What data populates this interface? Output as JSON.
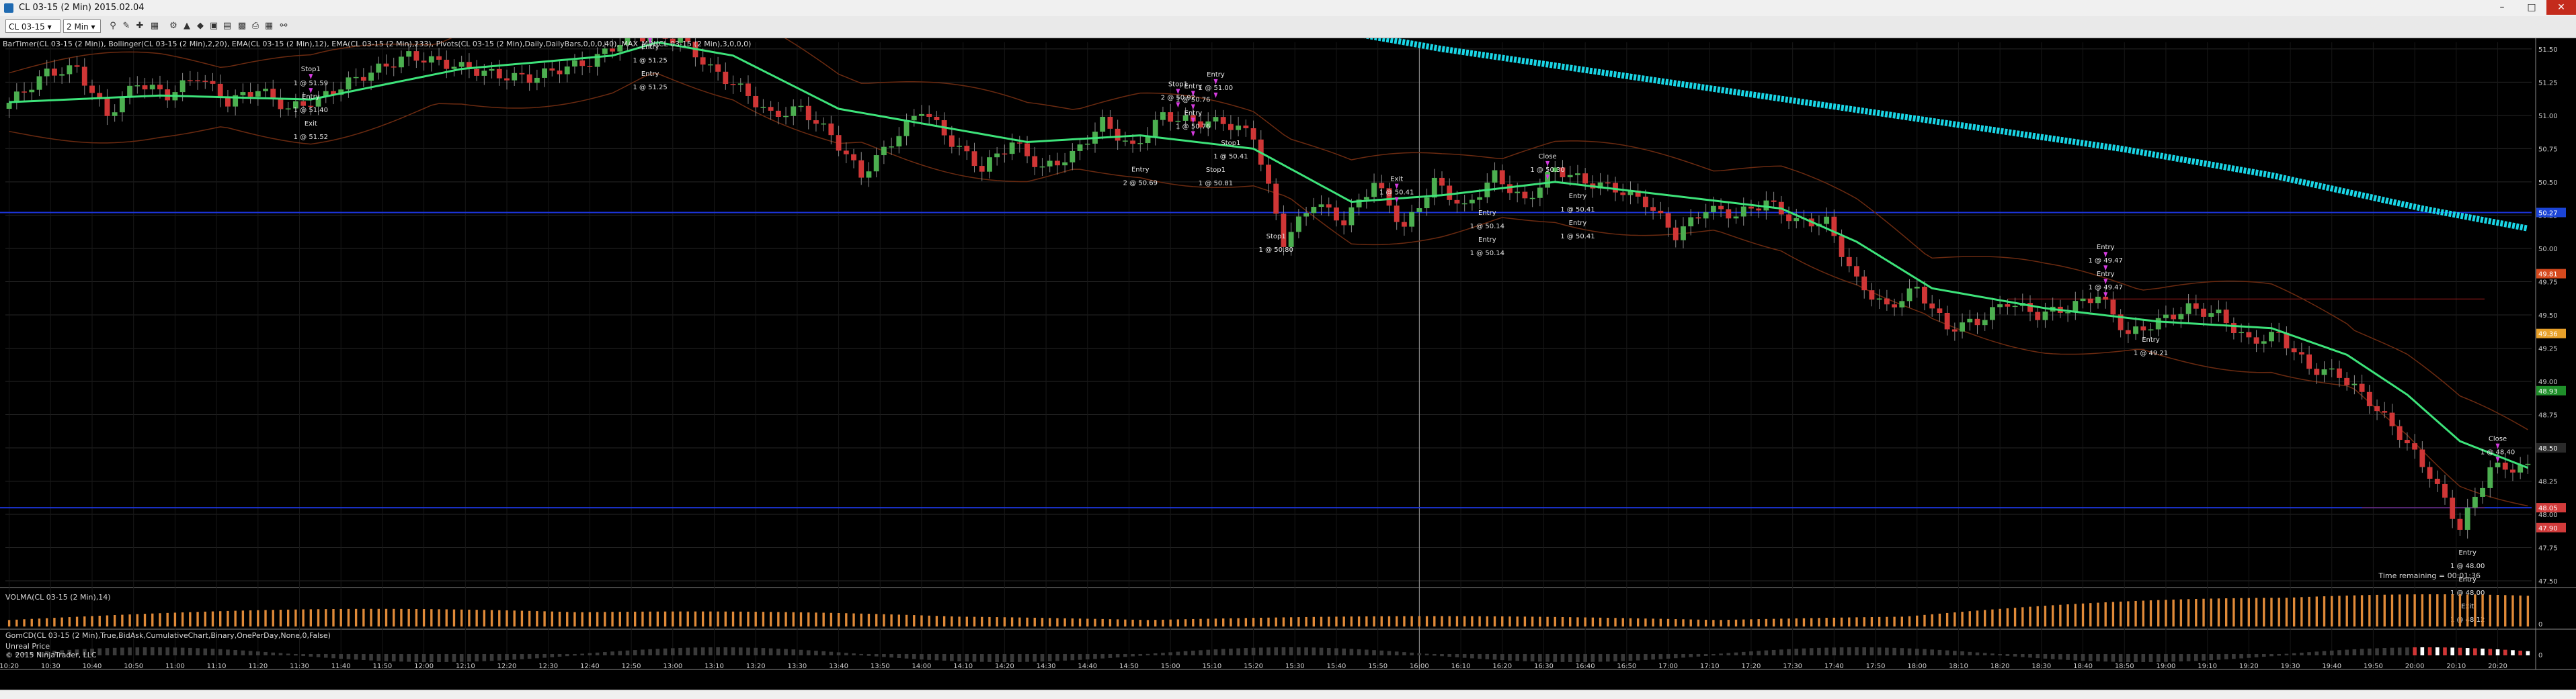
{
  "window": {
    "title": "CL 03-15 (2 Min)  2015.02.04",
    "min_label": "–",
    "max_label": "□",
    "close_label": "✕"
  },
  "toolbar": {
    "instrument": "CL 03-15 ▾",
    "interval": "2 Min ▾"
  },
  "indicators": {
    "price_panel": "BarTimer(CL 03-15 (2 Min)), Bollinger(CL 03-15 (2 Min),2,20), EMA(CL 03-15 (2 Min),12), EMA(CL 03-15 (2 Min),233), Pivots(CL 03-15 (2 Min),Daily,DailyBars,0,0,0,40), MAX_MIN(CL 03-15 (2 Min),3,0,0,0)",
    "volume_panel": "VOLMA(CL 03-15 (2 Min),14)",
    "cumdelta_panel": "GomCD(CL 03-15 (2 Min),True,BidAsk,CumulativeChart,Binary,OnePerDay,None,0,False)",
    "pos_sizing": "Unreal Price",
    "copyright": "© 2015 NinjaTrader, LLC",
    "time_remaining": "Time remaining = 00:01:36"
  },
  "chart_data": {
    "type": "candlestick",
    "title": "CL 03-15 (2 Min)",
    "ylim": [
      47.5,
      51.55
    ],
    "ylim_volume": [
      0,
      14000
    ],
    "price_ticks": [
      "51.50",
      "51.25",
      "51.00",
      "50.75",
      "50.50",
      "50.25",
      "50.00",
      "49.75",
      "49.50",
      "49.25",
      "49.00",
      "48.75",
      "48.50",
      "48.25",
      "48.00",
      "47.75",
      "47.50"
    ],
    "volume_ticks": [
      "0"
    ],
    "cumdelta_ticks": [
      "0"
    ],
    "time_ticks": [
      "10:20",
      "10:30",
      "10:40",
      "10:50",
      "11:00",
      "11:10",
      "11:20",
      "11:30",
      "11:40",
      "11:50",
      "12:00",
      "12:10",
      "12:20",
      "12:30",
      "12:40",
      "12:50",
      "13:00",
      "13:10",
      "13:20",
      "13:30",
      "13:40",
      "13:50",
      "14:00",
      "14:10",
      "14:20",
      "14:30",
      "14:40",
      "14:50",
      "15:00",
      "15:10",
      "15:20",
      "15:30",
      "15:40",
      "15:50",
      "16:00",
      "16:10",
      "16:20",
      "16:30",
      "16:40",
      "16:50",
      "17:00",
      "17:10",
      "17:20",
      "17:30",
      "17:40",
      "17:50",
      "18:00",
      "18:10",
      "18:20",
      "18:30",
      "18:40",
      "18:50",
      "19:00",
      "19:10",
      "19:20",
      "19:30",
      "19:40",
      "19:50",
      "20:00",
      "20:10",
      "20:20"
    ],
    "crosshair_time": "16:00",
    "price_path": [
      [
        0,
        51.05
      ],
      [
        6,
        51.32
      ],
      [
        10,
        51.35
      ],
      [
        14,
        51.0
      ],
      [
        18,
        51.25
      ],
      [
        22,
        51.15
      ],
      [
        26,
        51.3
      ],
      [
        30,
        51.1
      ],
      [
        34,
        51.2
      ],
      [
        38,
        51.05
      ],
      [
        42,
        51.12
      ],
      [
        46,
        51.25
      ],
      [
        50,
        51.35
      ],
      [
        54,
        51.45
      ],
      [
        58,
        51.4
      ],
      [
        62,
        51.35
      ],
      [
        66,
        51.3
      ],
      [
        70,
        51.28
      ],
      [
        74,
        51.35
      ],
      [
        78,
        51.4
      ],
      [
        82,
        51.55
      ],
      [
        84,
        51.6
      ],
      [
        90,
        51.58
      ],
      [
        94,
        51.35
      ],
      [
        98,
        51.2
      ],
      [
        102,
        51.0
      ],
      [
        106,
        51.05
      ],
      [
        110,
        50.85
      ],
      [
        114,
        50.55
      ],
      [
        118,
        50.8
      ],
      [
        122,
        51.05
      ],
      [
        126,
        50.8
      ],
      [
        130,
        50.6
      ],
      [
        134,
        50.8
      ],
      [
        138,
        50.6
      ],
      [
        142,
        50.7
      ],
      [
        146,
        50.95
      ],
      [
        150,
        50.75
      ],
      [
        154,
        51.0
      ],
      [
        158,
        50.95
      ],
      [
        162,
        50.95
      ],
      [
        166,
        50.85
      ],
      [
        170,
        50.05
      ],
      [
        174,
        50.35
      ],
      [
        178,
        50.2
      ],
      [
        182,
        50.5
      ],
      [
        186,
        50.15
      ],
      [
        190,
        50.5
      ],
      [
        194,
        50.3
      ],
      [
        198,
        50.55
      ],
      [
        202,
        50.35
      ],
      [
        206,
        50.6
      ],
      [
        210,
        50.5
      ],
      [
        214,
        50.45
      ],
      [
        218,
        50.35
      ],
      [
        222,
        50.1
      ],
      [
        226,
        50.3
      ],
      [
        230,
        50.25
      ],
      [
        234,
        50.35
      ],
      [
        238,
        50.2
      ],
      [
        242,
        50.2
      ],
      [
        246,
        49.75
      ],
      [
        250,
        49.55
      ],
      [
        254,
        49.7
      ],
      [
        258,
        49.4
      ],
      [
        262,
        49.45
      ],
      [
        266,
        49.6
      ],
      [
        270,
        49.5
      ],
      [
        274,
        49.55
      ],
      [
        278,
        49.65
      ],
      [
        282,
        49.35
      ],
      [
        286,
        49.45
      ],
      [
        290,
        49.55
      ],
      [
        294,
        49.5
      ],
      [
        298,
        49.3
      ],
      [
        302,
        49.35
      ],
      [
        306,
        49.1
      ],
      [
        310,
        49.05
      ],
      [
        314,
        48.85
      ],
      [
        318,
        48.6
      ],
      [
        322,
        48.3
      ],
      [
        326,
        47.9
      ],
      [
        330,
        48.35
      ],
      [
        334,
        48.35
      ]
    ],
    "ema12_path": [
      [
        0,
        51.1
      ],
      [
        20,
        51.15
      ],
      [
        40,
        51.12
      ],
      [
        60,
        51.35
      ],
      [
        80,
        51.45
      ],
      [
        86,
        51.55
      ],
      [
        96,
        51.45
      ],
      [
        110,
        51.05
      ],
      [
        120,
        50.95
      ],
      [
        135,
        50.8
      ],
      [
        150,
        50.85
      ],
      [
        165,
        50.75
      ],
      [
        178,
        50.35
      ],
      [
        190,
        50.4
      ],
      [
        205,
        50.5
      ],
      [
        220,
        50.4
      ],
      [
        235,
        50.3
      ],
      [
        245,
        50.05
      ],
      [
        255,
        49.7
      ],
      [
        270,
        49.55
      ],
      [
        285,
        49.45
      ],
      [
        300,
        49.4
      ],
      [
        310,
        49.2
      ],
      [
        318,
        48.9
      ],
      [
        325,
        48.55
      ],
      [
        334,
        48.35
      ]
    ],
    "ema233_path": [
      [
        170,
        51.7
      ],
      [
        190,
        51.5
      ],
      [
        220,
        51.25
      ],
      [
        250,
        51.0
      ],
      [
        280,
        50.75
      ],
      [
        300,
        50.55
      ],
      [
        320,
        50.3
      ],
      [
        334,
        50.15
      ]
    ],
    "pivot_lines": [
      50.27,
      48.05
    ],
    "pivot_tags": [
      "50.27",
      "48.05",
      "49.81",
      "49.36",
      "48.93",
      "48.50",
      "47.90"
    ],
    "cumdelta_values": [
      0
    ],
    "trade_labels": [
      {
        "pos": [
          40,
          49,
          0
        ],
        "text": "Stop1"
      },
      {
        "pos": [
          40,
          28,
          0
        ],
        "text": "1 @ 51.59"
      },
      {
        "pos": [
          40,
          8,
          1
        ],
        "text": "Entry"
      },
      {
        "pos": [
          40,
          -12,
          1
        ],
        "text": "1 @ 51.40"
      },
      {
        "pos": [
          40,
          -32,
          1
        ],
        "text": "Exit"
      },
      {
        "pos": [
          40,
          -52,
          1
        ],
        "text": "1 @ 51.52"
      },
      {
        "pos": [
          85,
          21,
          0
        ],
        "text": "Stop1"
      },
      {
        "pos": [
          85,
          1,
          0
        ],
        "text": "1 @ 51.16"
      },
      {
        "pos": [
          85,
          -19,
          1
        ],
        "text": "Entry"
      },
      {
        "pos": [
          85,
          -39,
          1
        ],
        "text": "1 @ 51.25"
      },
      {
        "pos": [
          85,
          -59,
          1
        ],
        "text": "Entry"
      },
      {
        "pos": [
          85,
          -79,
          1
        ],
        "text": "1 @ 51.25"
      },
      {
        "pos": [
          155,
          46,
          0
        ],
        "text": "Stop1"
      },
      {
        "pos": [
          155,
          26,
          0
        ],
        "text": "2 @ 50.92"
      },
      {
        "pos": [
          150,
          -34,
          1
        ],
        "text": "Entry"
      },
      {
        "pos": [
          150,
          -54,
          1
        ],
        "text": "2 @ 50.69"
      },
      {
        "pos": [
          160,
          68,
          0
        ],
        "text": "Entry"
      },
      {
        "pos": [
          160,
          48,
          0
        ],
        "text": "1 @ 51.00"
      },
      {
        "pos": [
          157,
          48,
          0
        ],
        "text": "Entry"
      },
      {
        "pos": [
          157,
          28,
          0
        ],
        "text": "1 @ 50.76"
      },
      {
        "pos": [
          157,
          8,
          0
        ],
        "text": "Entry"
      },
      {
        "pos": [
          157,
          -12,
          0
        ],
        "text": "1 @ 50.76"
      },
      {
        "pos": [
          162,
          -34,
          1
        ],
        "text": "Stop1"
      },
      {
        "pos": [
          162,
          -54,
          1
        ],
        "text": "1 @ 50.41"
      },
      {
        "pos": [
          160,
          -74,
          1
        ],
        "text": "Stop1"
      },
      {
        "pos": [
          160,
          -94,
          1
        ],
        "text": "1 @ 50.81"
      },
      {
        "pos": [
          168,
          -74,
          1
        ],
        "text": "Stop1"
      },
      {
        "pos": [
          168,
          -94,
          1
        ],
        "text": "1 @ 50.80"
      },
      {
        "pos": [
          184,
          36,
          0
        ],
        "text": "Exit"
      },
      {
        "pos": [
          184,
          16,
          0
        ],
        "text": "1 @ 50.41"
      },
      {
        "pos": [
          196,
          -34,
          1
        ],
        "text": "Entry"
      },
      {
        "pos": [
          196,
          -54,
          1
        ],
        "text": "1 @ 50.14"
      },
      {
        "pos": [
          196,
          -74,
          1
        ],
        "text": "Entry"
      },
      {
        "pos": [
          196,
          -94,
          1
        ],
        "text": "1 @ 50.14"
      },
      {
        "pos": [
          204,
          40,
          0
        ],
        "text": "Close"
      },
      {
        "pos": [
          204,
          20,
          0
        ],
        "text": "1 @ 50.30"
      },
      {
        "pos": [
          208,
          -34,
          1
        ],
        "text": "Entry"
      },
      {
        "pos": [
          208,
          -54,
          1
        ],
        "text": "1 @ 50.41"
      },
      {
        "pos": [
          208,
          -74,
          1
        ],
        "text": "Entry"
      },
      {
        "pos": [
          208,
          -94,
          1
        ],
        "text": "1 @ 50.41"
      },
      {
        "pos": [
          278,
          68,
          0
        ],
        "text": "Entry"
      },
      {
        "pos": [
          278,
          48,
          0
        ],
        "text": "1 @ 49.47"
      },
      {
        "pos": [
          278,
          28,
          0
        ],
        "text": "Entry"
      },
      {
        "pos": [
          278,
          8,
          0
        ],
        "text": "1 @ 49.47"
      },
      {
        "pos": [
          284,
          -20,
          1
        ],
        "text": "Entry"
      },
      {
        "pos": [
          284,
          -40,
          1
        ],
        "text": "1 @ 49.21"
      },
      {
        "pos": [
          330,
          40,
          0
        ],
        "text": "Close"
      },
      {
        "pos": [
          330,
          20,
          0
        ],
        "text": "1 @ 48.40"
      },
      {
        "pos": [
          326,
          -40,
          1
        ],
        "text": "Entry"
      },
      {
        "pos": [
          326,
          -60,
          1
        ],
        "text": "1 @ 48.00"
      },
      {
        "pos": [
          326,
          -80,
          1
        ],
        "text": "Entry"
      },
      {
        "pos": [
          326,
          -100,
          1
        ],
        "text": "1 @ 48.00"
      },
      {
        "pos": [
          326,
          -120,
          1
        ],
        "text": "Exit"
      },
      {
        "pos": [
          326,
          -140,
          1
        ],
        "text": "1 @ 48.12"
      }
    ]
  }
}
